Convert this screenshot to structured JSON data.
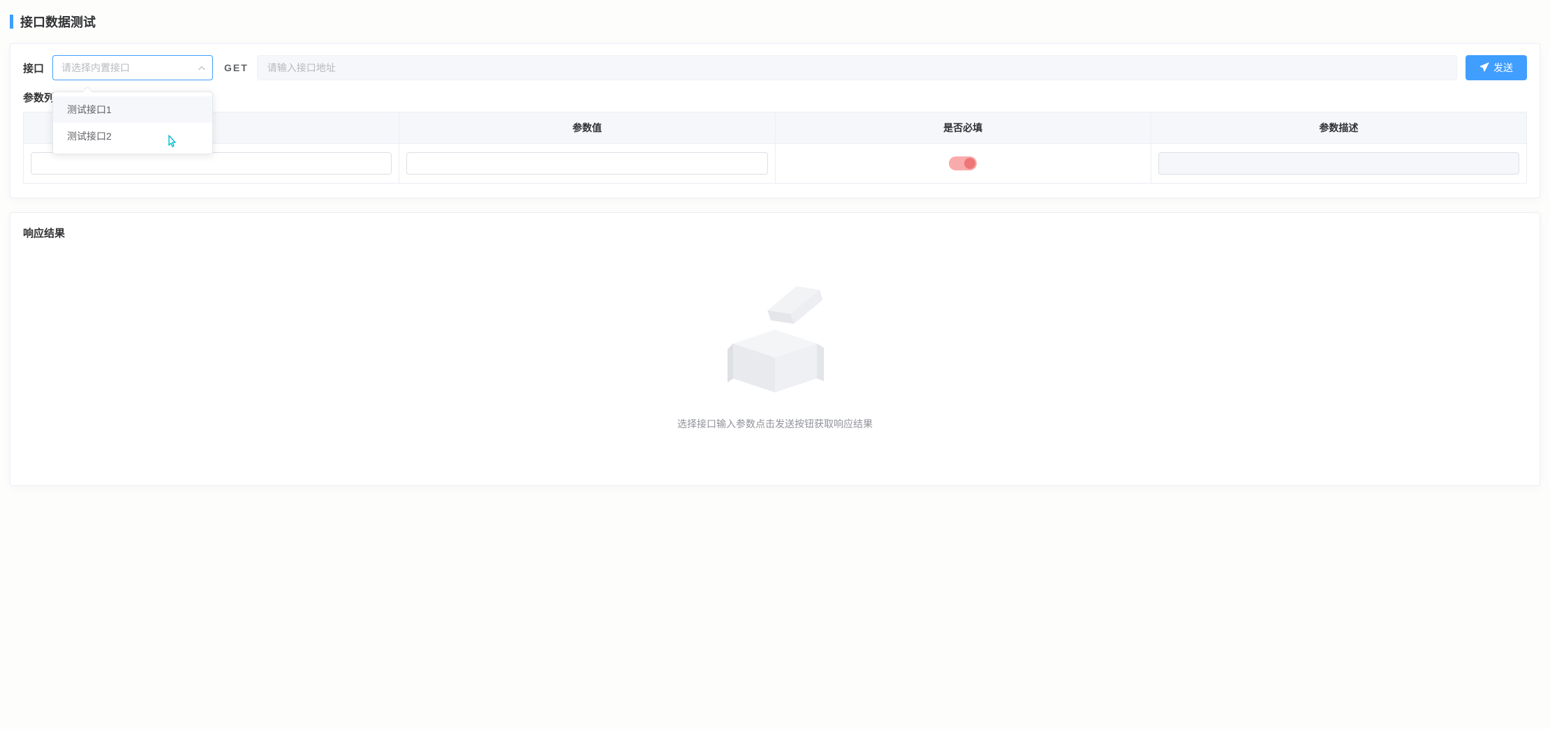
{
  "page": {
    "title": "接口数据测试"
  },
  "request": {
    "interface_label": "接口",
    "select_placeholder": "请选择内置接口",
    "dropdown_options": [
      {
        "label": "测试接口1"
      },
      {
        "label": "测试接口2"
      }
    ],
    "method": "GET",
    "url_placeholder": "请输入接口地址",
    "send_label": "发送"
  },
  "params": {
    "list_label": "参数列",
    "columns": {
      "value": "参数值",
      "required": "是否必填",
      "description": "参数描述"
    },
    "row": {
      "name_value": "",
      "value_value": "",
      "required": true,
      "description_value": ""
    }
  },
  "response": {
    "title": "响应结果",
    "empty_text": "选择接口输入参数点击发送按钮获取响应结果"
  }
}
